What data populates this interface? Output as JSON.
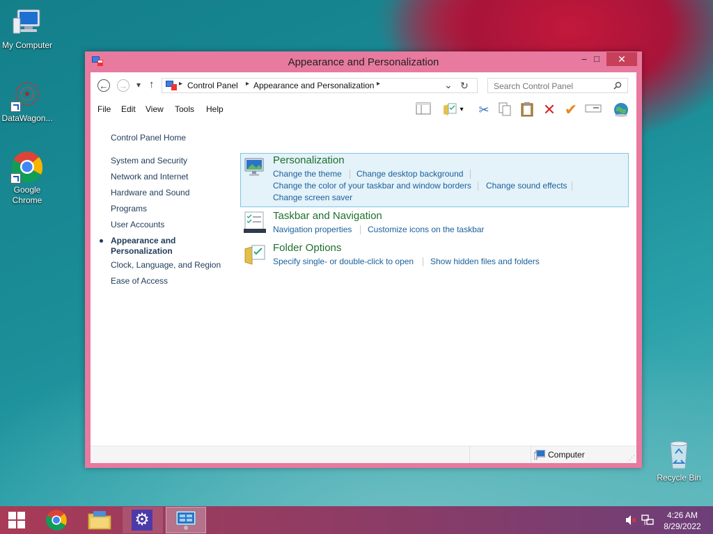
{
  "desktop": {
    "icons": [
      {
        "label": "My Computer"
      },
      {
        "label": "DataWagon..."
      },
      {
        "label": "Google Chrome"
      },
      {
        "label": "Recycle Bin"
      }
    ]
  },
  "window": {
    "title": "Appearance and Personalization",
    "caption": {
      "minimize": "–",
      "maximize": "□",
      "close": "✕"
    },
    "nav": {
      "back": "←",
      "forward": "→",
      "recent": "▾",
      "up": "↑",
      "breadcrumb": [
        "Control Panel",
        "Appearance and Personalization"
      ],
      "refresh": "↻",
      "search_placeholder": "Search Control Panel"
    },
    "menu": [
      "File",
      "Edit",
      "View",
      "Tools",
      "Help"
    ],
    "left_nav": {
      "home": "Control Panel Home",
      "items": [
        "System and Security",
        "Network and Internet",
        "Hardware and Sound",
        "Programs",
        "User Accounts",
        "Appearance and Personalization",
        "Clock, Language, and Region",
        "Ease of Access"
      ],
      "active_line1": "Appearance and",
      "active_line2": "Personalization"
    },
    "categories": {
      "personalization": {
        "title": "Personalization",
        "links": [
          "Change the theme",
          "Change desktop background",
          "Change the color of your taskbar and window borders",
          "Change sound effects",
          "Change screen saver"
        ]
      },
      "taskbar": {
        "title": "Taskbar and Navigation",
        "links": [
          "Navigation properties",
          "Customize icons on the taskbar"
        ]
      },
      "folder": {
        "title": "Folder Options",
        "links": [
          "Specify single- or double-click to open",
          "Show hidden files and folders"
        ]
      }
    },
    "status": {
      "location": "Computer"
    }
  },
  "taskbar": {
    "time": "4:26 AM",
    "date": "8/29/2022"
  },
  "colors": {
    "window_frame": "#e8799f",
    "close_button": "#c7405a",
    "category_title": "#1e6f2c",
    "link": "#1a5f9a",
    "selected_bg": "#e4f2f9",
    "selected_border": "#7fc5e6"
  }
}
